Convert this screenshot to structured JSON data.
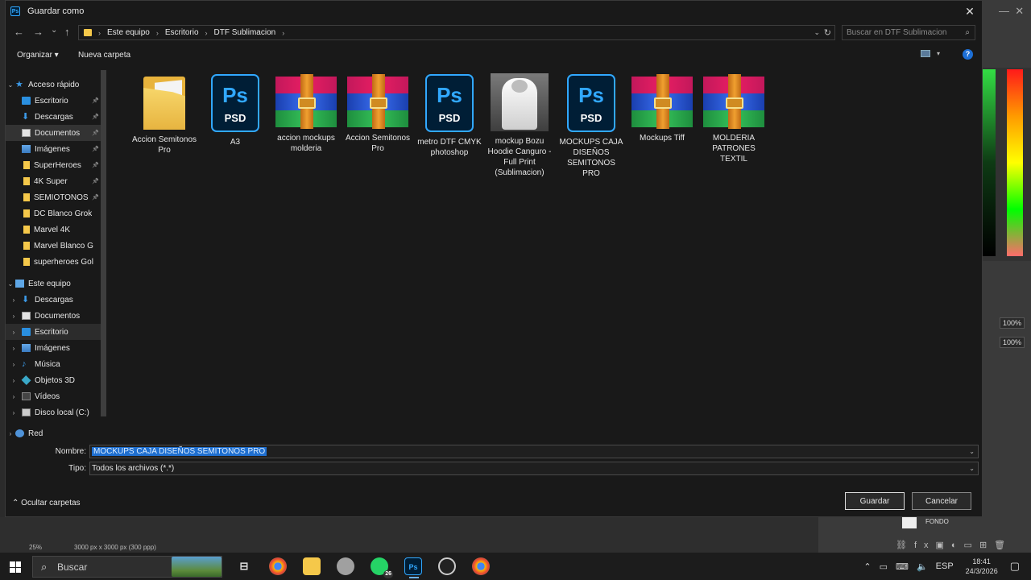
{
  "dialog": {
    "title": "Guardar como",
    "close": "✕",
    "app_badge": "Ps"
  },
  "nav": {
    "back": "←",
    "forward": "→",
    "recent": "⌄",
    "up": "↑",
    "breadcrumb": [
      "Este equipo",
      "Escritorio",
      "DTF Sublimacion"
    ],
    "search_placeholder": "Buscar en DTF Sublimacion"
  },
  "toolbar": {
    "organize": "Organizar ▾",
    "new_folder": "Nueva carpeta",
    "help": "?"
  },
  "sidebar": {
    "quick_access": "Acceso rápido",
    "quick_items": [
      {
        "label": "Escritorio",
        "icon": "desktop-icon"
      },
      {
        "label": "Descargas",
        "icon": "download-icon"
      },
      {
        "label": "Documentos",
        "icon": "document-icon"
      },
      {
        "label": "Imágenes",
        "icon": "pictures-icon"
      },
      {
        "label": "SuperHeroes",
        "icon": "folder-icon"
      },
      {
        "label": "4K Super",
        "icon": "folder-icon"
      },
      {
        "label": "SEMIOTONOS",
        "icon": "folder-icon"
      },
      {
        "label": "DC Blanco Grok",
        "icon": "folder-icon"
      },
      {
        "label": "Marvel 4K",
        "icon": "folder-icon"
      },
      {
        "label": "Marvel Blanco G",
        "icon": "folder-icon"
      },
      {
        "label": "superheroes Gol",
        "icon": "folder-icon"
      }
    ],
    "this_pc": "Este equipo",
    "pc_items": [
      {
        "label": "Descargas",
        "icon": "download-icon"
      },
      {
        "label": "Documentos",
        "icon": "document-icon"
      },
      {
        "label": "Escritorio",
        "icon": "desktop-icon"
      },
      {
        "label": "Imágenes",
        "icon": "pictures-icon"
      },
      {
        "label": "Música",
        "icon": "music-icon"
      },
      {
        "label": "Objetos 3D",
        "icon": "objects-3d-icon"
      },
      {
        "label": "Vídeos",
        "icon": "videos-icon"
      },
      {
        "label": "Disco local (C:)",
        "icon": "disk-icon"
      }
    ],
    "network": "Red"
  },
  "files": [
    {
      "type": "folder",
      "label": "Accion Semitonos Pro"
    },
    {
      "type": "psd",
      "label": "A3"
    },
    {
      "type": "rar",
      "label": "accion mockups molderia"
    },
    {
      "type": "rar",
      "label": "Accion Semitonos Pro"
    },
    {
      "type": "psd",
      "label": "metro DTF CMYK photoshop"
    },
    {
      "type": "hoodie",
      "label": "mockup Bozu Hoodie Canguro - Full Print (Sublimacion)"
    },
    {
      "type": "psd",
      "label": "MOCKUPS CAJA DISEÑOS SEMITONOS PRO"
    },
    {
      "type": "rar",
      "label": "Mockups Tiff"
    },
    {
      "type": "rar",
      "label": "MOLDERIA PATRONES TEXTIL"
    }
  ],
  "psd_badge": {
    "ps": "Ps",
    "ext": "PSD"
  },
  "form": {
    "name_label": "Nombre:",
    "name_value": "MOCKUPS CAJA DISEÑOS SEMITONOS PRO",
    "type_label": "Tipo:",
    "type_value": "Todos los archivos (*.*)",
    "hide_folders": "Ocultar carpetas",
    "save": "Guardar",
    "cancel": "Cancelar"
  },
  "background": {
    "zoom": "25%",
    "doc_size": "3000 px x 3000 px (300 ppp)",
    "layer_name": "FONDO",
    "opacity1": "100%",
    "opacity2": "100%"
  },
  "taskbar": {
    "search": "Buscar",
    "lang": "ESP",
    "time": "18:41",
    "date": "24/3/2026",
    "whatsapp_badge": "26"
  },
  "colors": {
    "accent": "#1f6fd0",
    "ps_blue": "#31a8ff",
    "folder_yellow": "#f5c84a"
  }
}
